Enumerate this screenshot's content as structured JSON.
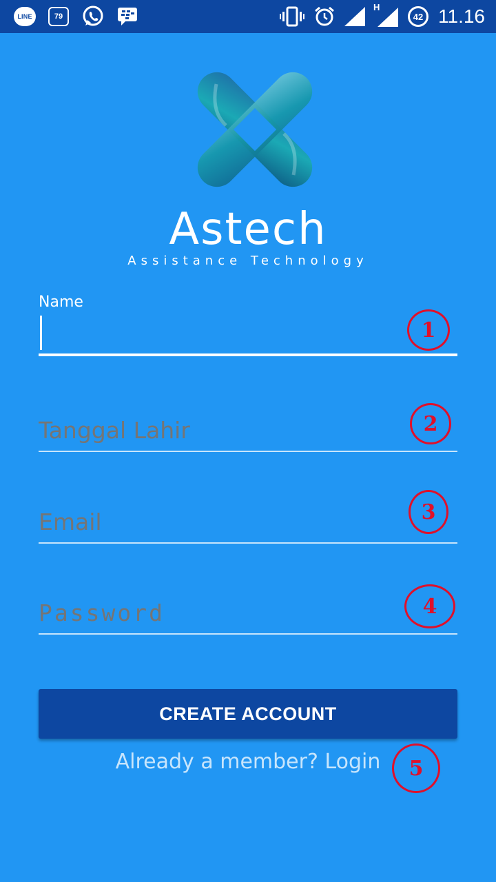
{
  "status_bar": {
    "line_label": "LINE",
    "badge_count": "79",
    "battery_level": "42",
    "time": "11.16",
    "network_type": "H",
    "icons": [
      "line-icon",
      "calendar-badge-icon",
      "whatsapp-icon",
      "bbm-icon",
      "vibrate-icon",
      "alarm-icon",
      "signal-icon",
      "signal-h-icon",
      "battery-icon"
    ]
  },
  "app": {
    "title": "Astech",
    "subtitle": "Assistance Technology"
  },
  "form": {
    "name_label": "Name",
    "name_value": "",
    "birthdate_placeholder": "Tanggal Lahir",
    "email_placeholder": "Email",
    "password_placeholder": "Password"
  },
  "actions": {
    "create_account": "CREATE ACCOUNT",
    "login_link": "Already a member? Login"
  },
  "annotations": [
    "1",
    "2",
    "3",
    "4",
    "5"
  ],
  "colors": {
    "background": "#2196F3",
    "status_bar": "#0D47A1",
    "button": "#0D47A1",
    "annotation": "#E0102A"
  }
}
